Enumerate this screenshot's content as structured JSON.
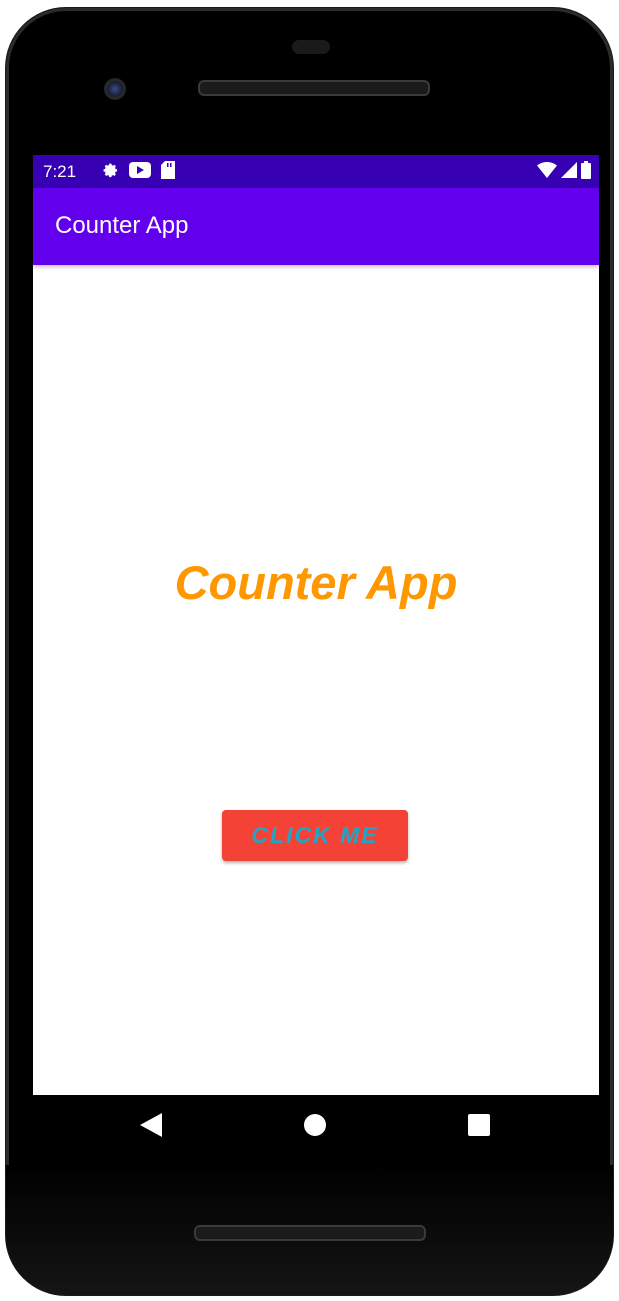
{
  "status_bar": {
    "time": "7:21",
    "left_icons": [
      "gear-icon",
      "play-icon",
      "sd-card-icon"
    ],
    "right_icons": [
      "wifi-icon",
      "signal-icon",
      "battery-icon"
    ],
    "background": "#3700b3"
  },
  "app_bar": {
    "title": "Counter App",
    "background": "#6200ee"
  },
  "main": {
    "title": "Counter App",
    "title_color": "#ff9800",
    "button_label": "CLICK ME",
    "button_color": "#f44336",
    "button_text_color": "#1ea5c7"
  },
  "nav_bar": {
    "buttons": [
      "back-icon",
      "home-icon",
      "recents-icon"
    ]
  }
}
